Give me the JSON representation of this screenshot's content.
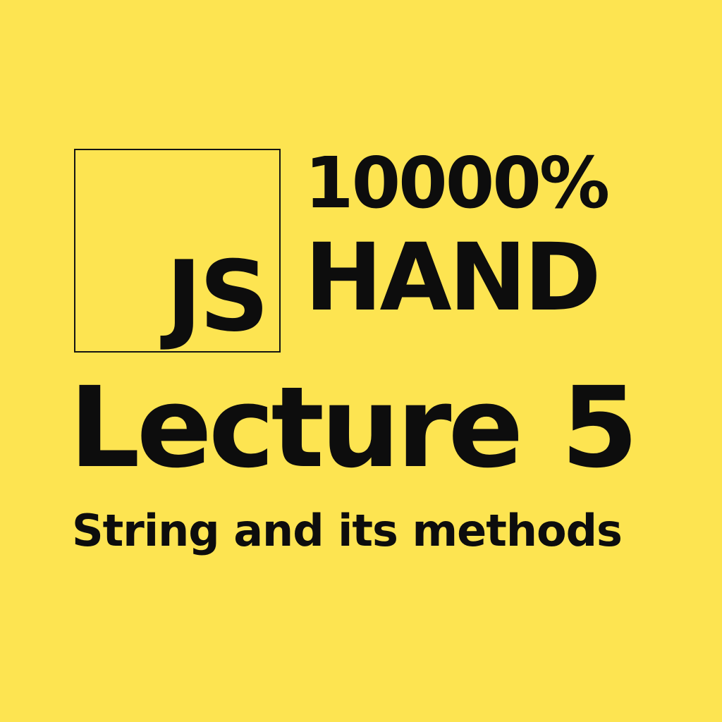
{
  "logo": {
    "text": "JS"
  },
  "headline": {
    "line1": "10000%",
    "line2": "HAND"
  },
  "lecture": {
    "word": "Lecture",
    "number": "5"
  },
  "subtitle": "String and its methods",
  "colors": {
    "background": "#FDE451",
    "text": "#0d0d0d",
    "box_border": "#151512"
  }
}
